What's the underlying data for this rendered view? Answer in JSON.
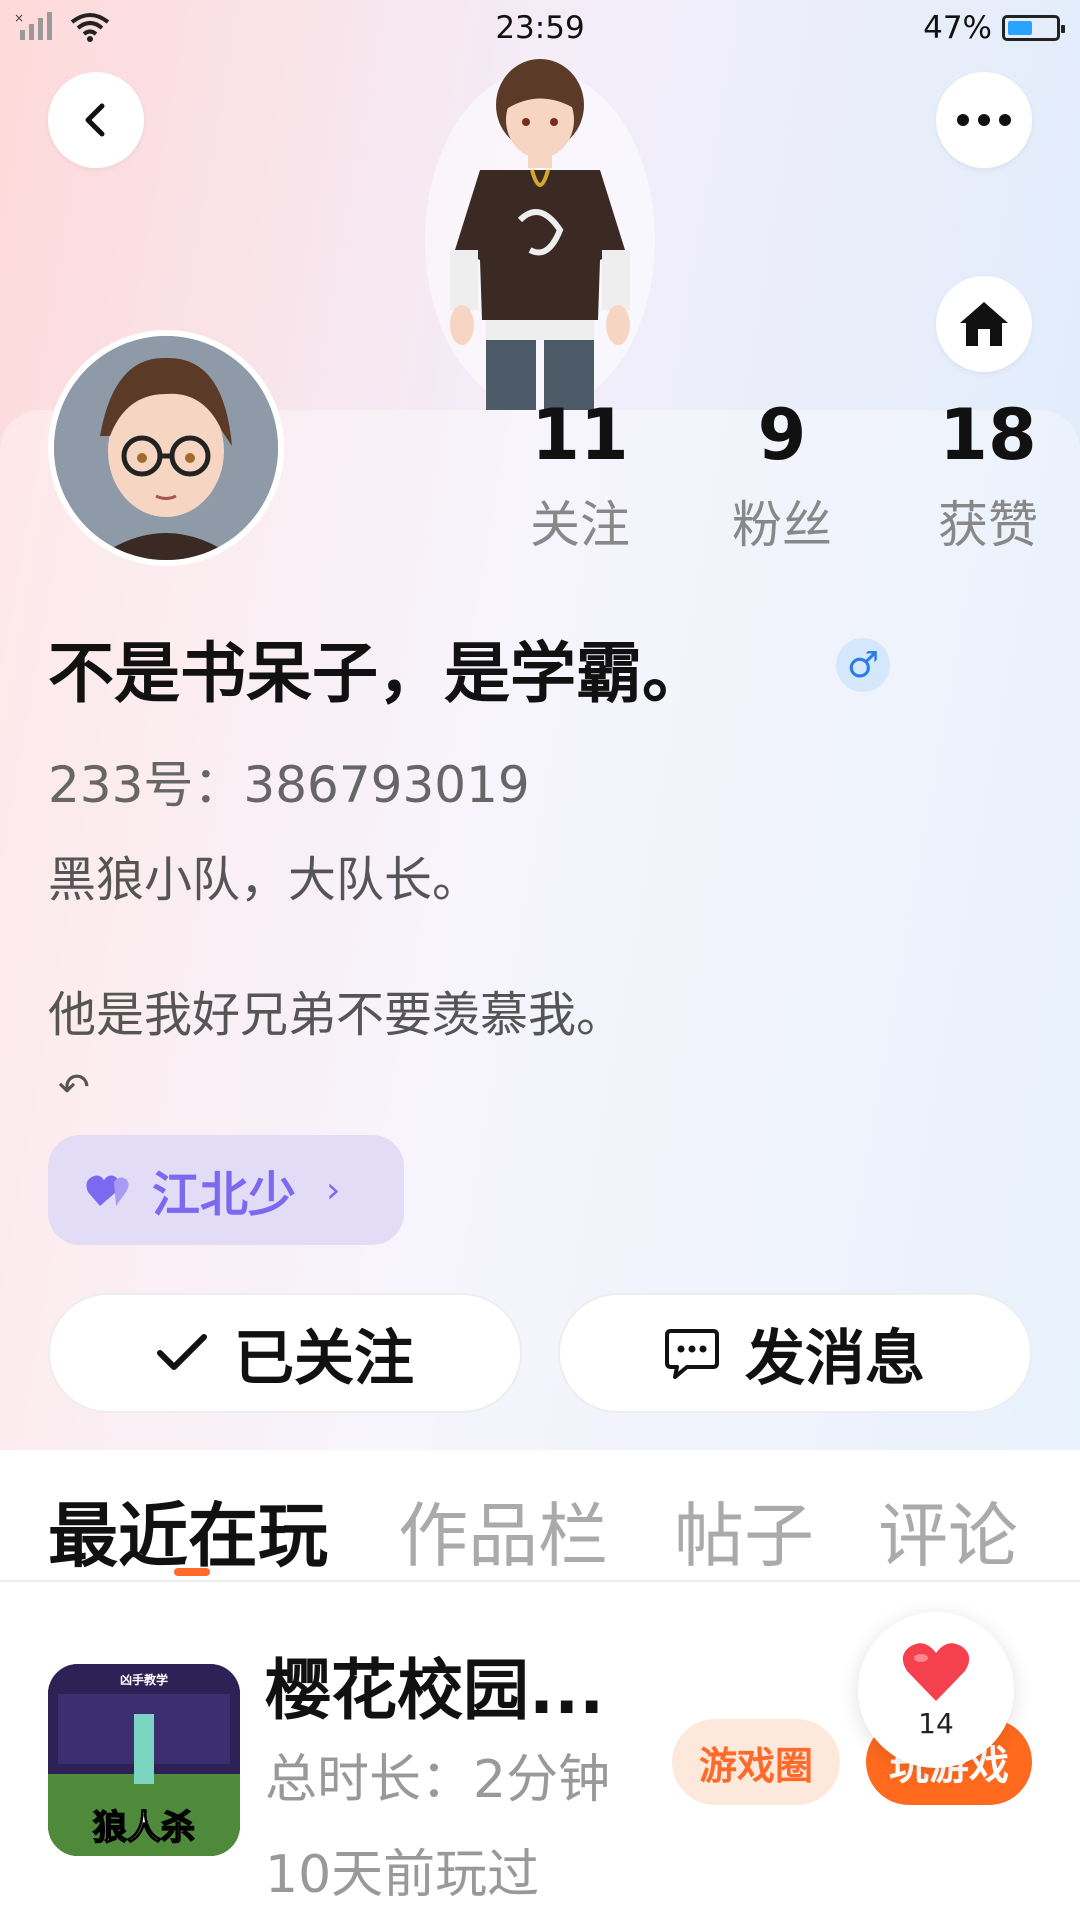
{
  "status": {
    "time": "23:59",
    "battery": "47%",
    "battery_level": 0.47
  },
  "stats": [
    {
      "num": "11",
      "label": "关注"
    },
    {
      "num": "9",
      "label": "粉丝"
    },
    {
      "num": "18",
      "label": "获赞"
    }
  ],
  "profile": {
    "name": "不是书呆子，是学霸。",
    "gender_symbol": "♂",
    "uid": "233号：386793019",
    "bio_line1": "黑狼小队，大队长。",
    "bio_line2": "他是我好兄弟不要羡慕我。",
    "bio_icon": "↶",
    "friend_tag": "江北少",
    "friend_chevron": "›"
  },
  "actions": {
    "followed_label": "已关注",
    "message_label": "发消息"
  },
  "tabs": [
    "最近在玩",
    "作品栏",
    "帖子",
    "评论"
  ],
  "game": {
    "title": "樱花校园...",
    "duration": "总时长：2分钟",
    "last_played": "10天前玩过",
    "circle_label": "游戏圈",
    "play_label": "玩游戏",
    "icon_text": "狼人杀",
    "icon_header": "凶手教学",
    "like_count": "14"
  },
  "colors": {
    "accent": "#ff6a2a",
    "tag_text": "#7b6af0",
    "tag_bg": "#e3dcf7",
    "gender_blue": "#2b7de9"
  }
}
